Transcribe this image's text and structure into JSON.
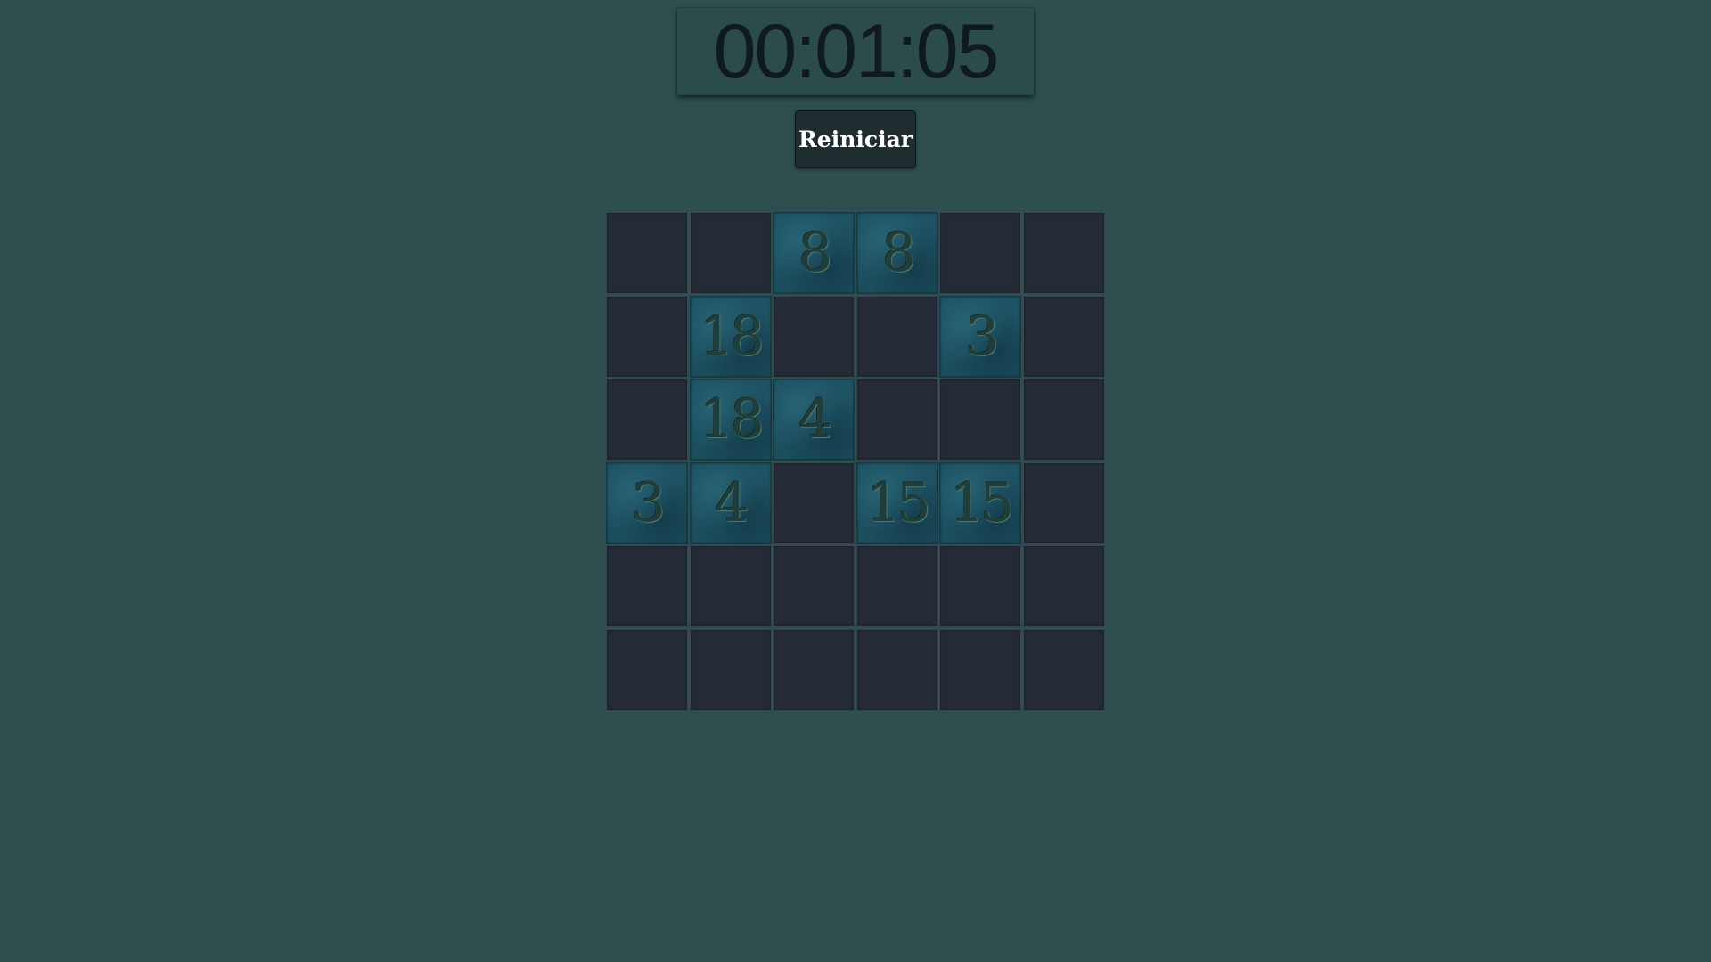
{
  "timer": {
    "display": "00:01:05"
  },
  "controls": {
    "restart_label": "Reiniciar"
  },
  "board": {
    "rows": 6,
    "cols": 6,
    "cells": [
      [
        "",
        "",
        "8",
        "8",
        "",
        ""
      ],
      [
        "",
        "18",
        "",
        "",
        "3",
        ""
      ],
      [
        "",
        "18",
        "4",
        "",
        "",
        ""
      ],
      [
        "3",
        "4",
        "",
        "15",
        "15",
        ""
      ],
      [
        "",
        "",
        "",
        "",
        "",
        ""
      ],
      [
        "",
        "",
        "",
        "",
        "",
        ""
      ]
    ]
  }
}
